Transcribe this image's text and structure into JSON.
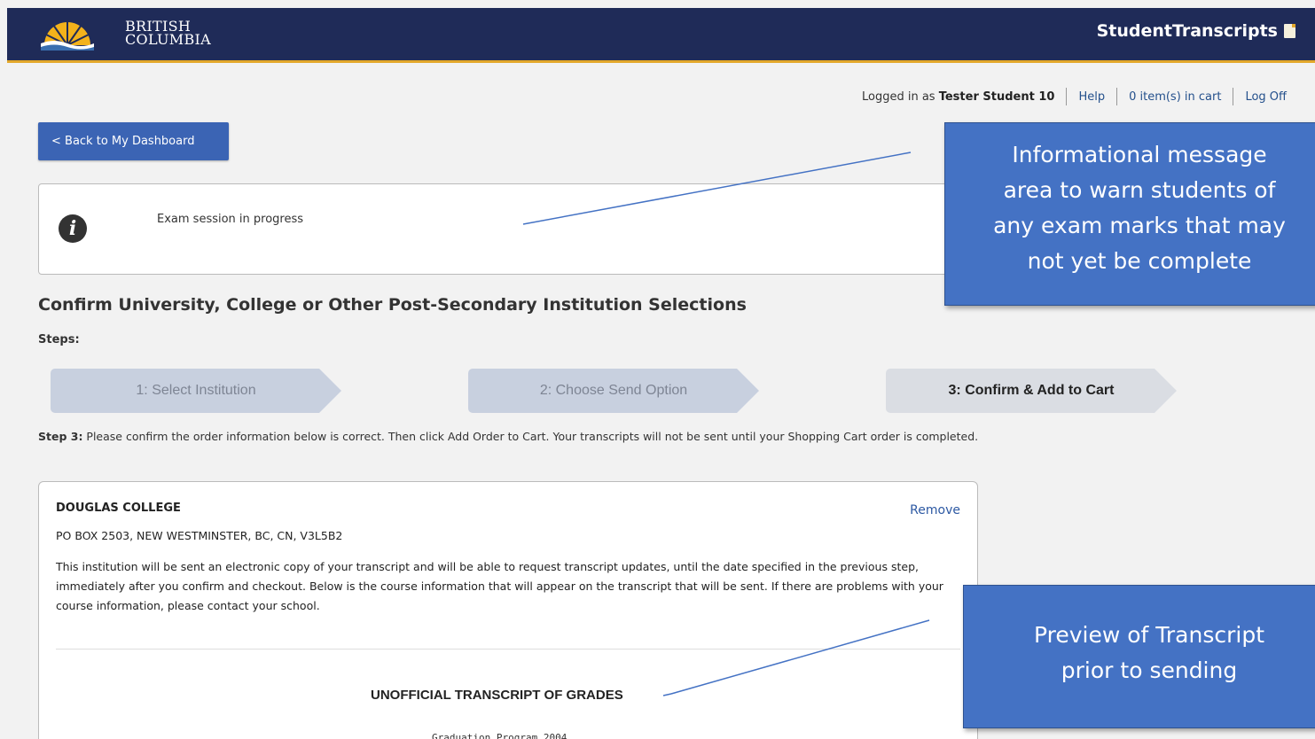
{
  "header": {
    "logo_line1": "BRITISH",
    "logo_line2": "COLUMBIA",
    "app_name": "StudentTranscripts"
  },
  "userbar": {
    "logged_in_prefix": "Logged in as",
    "user_name": "Tester Student 10",
    "help": "Help",
    "cart": "0 item(s) in cart",
    "logoff": "Log Off"
  },
  "back_button": "< Back to My Dashboard",
  "info_message": "Exam session in progress",
  "page_title": "Confirm University, College or Other Post-Secondary Institution Selections",
  "steps_label": "Steps:",
  "steps": [
    {
      "label": "1: Select Institution",
      "active": false
    },
    {
      "label": "2: Choose Send Option",
      "active": false
    },
    {
      "label": "3: Confirm & Add to Cart",
      "active": true
    }
  ],
  "step_description": {
    "prefix": "Step 3:",
    "text": " Please confirm the order information below is correct. Then click Add Order to Cart. Your transcripts will not be sent until your Shopping Cart order is completed."
  },
  "order": {
    "institution_name": "DOUGLAS COLLEGE",
    "remove": "Remove",
    "address": "PO BOX 2503, NEW WESTMINSTER, BC, CN, V3L5B2",
    "description": "This institution will be sent an electronic copy of your transcript and will be able to request transcript updates, until the date specified in the previous step, immediately after you confirm and checkout. Below is the course information that will appear on the transcript that will be sent. If there are problems with your course information, please contact your school.",
    "transcript_title": "UNOFFICIAL TRANSCRIPT OF GRADES",
    "program": "Graduation Program 2004"
  },
  "callouts": {
    "info_area": [
      "Informational message",
      "area to warn students of",
      "any exam marks that may",
      "not yet be complete"
    ],
    "preview": [
      "Preview of Transcript",
      "prior to sending"
    ]
  },
  "colors": {
    "header_bg": "#1f2b58",
    "header_accent": "#e3a82b",
    "button_bg": "#3b64b4",
    "callout_bg": "#4472c4",
    "link": "#24508c"
  }
}
